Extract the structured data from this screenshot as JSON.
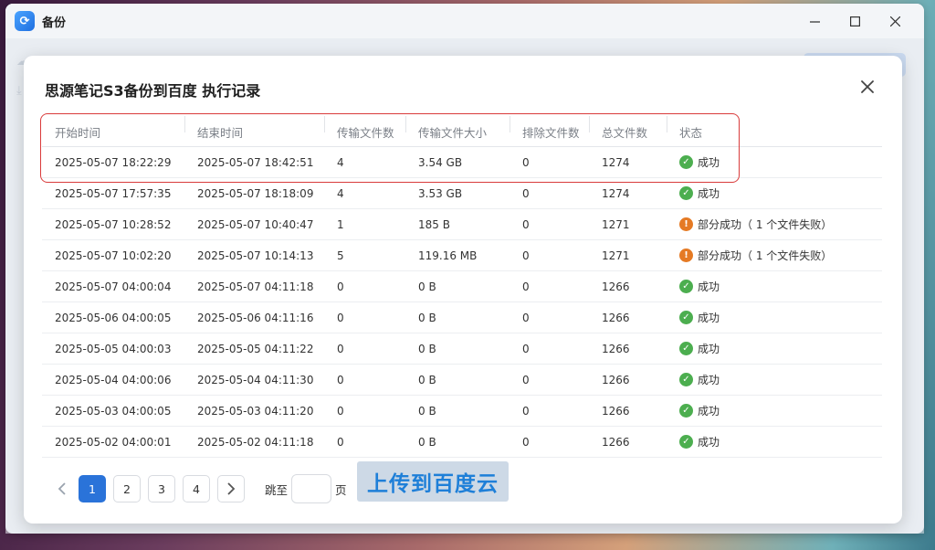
{
  "window": {
    "title": "备份"
  },
  "modal": {
    "title": "思源笔记S3备份到百度 执行记录"
  },
  "table": {
    "columns": [
      "开始时间",
      "结束时间",
      "传输文件数",
      "传输文件大小",
      "排除文件数",
      "总文件数",
      "状态"
    ],
    "rows": [
      {
        "start": "2025-05-07 18:22:29",
        "end": "2025-05-07 18:42:51",
        "transferred": "4",
        "size": "3.54 GB",
        "excluded": "0",
        "total": "1274",
        "status": "成功",
        "status_type": "ok"
      },
      {
        "start": "2025-05-07 17:57:35",
        "end": "2025-05-07 18:18:09",
        "transferred": "4",
        "size": "3.53 GB",
        "excluded": "0",
        "total": "1274",
        "status": "成功",
        "status_type": "ok"
      },
      {
        "start": "2025-05-07 10:28:52",
        "end": "2025-05-07 10:40:47",
        "transferred": "1",
        "size": "185 B",
        "excluded": "0",
        "total": "1271",
        "status": "部分成功（ 1 个文件失败）",
        "status_type": "warn"
      },
      {
        "start": "2025-05-07 10:02:20",
        "end": "2025-05-07 10:14:13",
        "transferred": "5",
        "size": "119.16 MB",
        "excluded": "0",
        "total": "1271",
        "status": "部分成功（ 1 个文件失败）",
        "status_type": "warn"
      },
      {
        "start": "2025-05-07 04:00:04",
        "end": "2025-05-07 04:11:18",
        "transferred": "0",
        "size": "0 B",
        "excluded": "0",
        "total": "1266",
        "status": "成功",
        "status_type": "ok"
      },
      {
        "start": "2025-05-06 04:00:05",
        "end": "2025-05-06 04:11:16",
        "transferred": "0",
        "size": "0 B",
        "excluded": "0",
        "total": "1266",
        "status": "成功",
        "status_type": "ok"
      },
      {
        "start": "2025-05-05 04:00:03",
        "end": "2025-05-05 04:11:22",
        "transferred": "0",
        "size": "0 B",
        "excluded": "0",
        "total": "1266",
        "status": "成功",
        "status_type": "ok"
      },
      {
        "start": "2025-05-04 04:00:06",
        "end": "2025-05-04 04:11:30",
        "transferred": "0",
        "size": "0 B",
        "excluded": "0",
        "total": "1266",
        "status": "成功",
        "status_type": "ok"
      },
      {
        "start": "2025-05-03 04:00:05",
        "end": "2025-05-03 04:11:20",
        "transferred": "0",
        "size": "0 B",
        "excluded": "0",
        "total": "1266",
        "status": "成功",
        "status_type": "ok"
      },
      {
        "start": "2025-05-02 04:00:01",
        "end": "2025-05-02 04:11:18",
        "transferred": "0",
        "size": "0 B",
        "excluded": "0",
        "total": "1266",
        "status": "成功",
        "status_type": "ok"
      }
    ]
  },
  "pagination": {
    "pages": [
      "1",
      "2",
      "3",
      "4"
    ],
    "current": "1",
    "jump_label": "跳至",
    "page_unit": "页"
  },
  "overlay_text": "上传到百度云",
  "colors": {
    "accent": "#2a73d9",
    "success": "#4cae4f",
    "warning": "#e57a24",
    "highlight_border": "#d93b3b"
  },
  "icons": {
    "close": "close-icon",
    "prev": "chevron-left-icon",
    "next": "chevron-right-icon",
    "success": "check-circle-icon",
    "warning": "info-circle-icon"
  }
}
